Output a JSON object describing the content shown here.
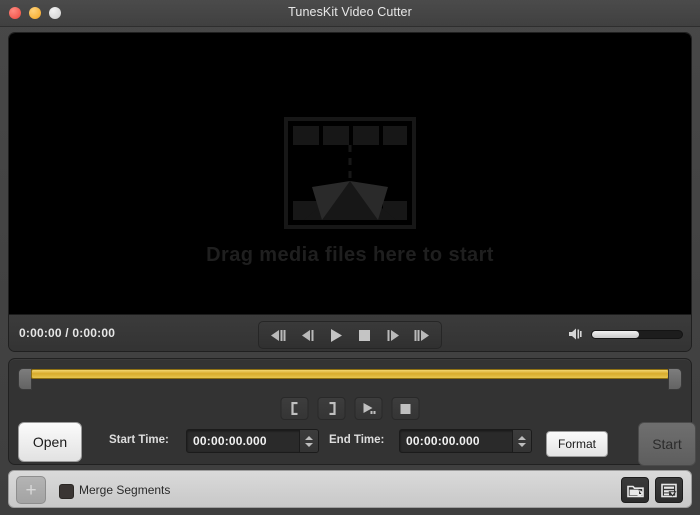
{
  "window": {
    "title": "TunesKit Video Cutter",
    "traffic_lights": [
      {
        "name": "close",
        "color": "#f35c52"
      },
      {
        "name": "minimize",
        "color": "#f8b43c"
      },
      {
        "name": "zoom",
        "color": "#d9d9d9"
      }
    ]
  },
  "video": {
    "drop_hint": "Drag media files here to start",
    "placeholder_icon": "film-strip-cut-icon",
    "background_color": "#000000"
  },
  "transport": {
    "timecode": "0:00:00 / 0:00:00",
    "current_time": "0:00:00",
    "total_time": "0:00:00",
    "buttons": [
      {
        "name": "previous-segment-button",
        "icon": "skip-backward-icon"
      },
      {
        "name": "step-backward-button",
        "icon": "step-backward-icon"
      },
      {
        "name": "play-button",
        "icon": "play-icon"
      },
      {
        "name": "stop-button",
        "icon": "stop-icon"
      },
      {
        "name": "step-forward-button",
        "icon": "step-forward-icon"
      },
      {
        "name": "next-segment-button",
        "icon": "skip-forward-icon"
      }
    ],
    "volume": {
      "icon": "speaker-volume-icon",
      "level_percent": 52
    }
  },
  "timeline": {
    "bar_color": "#d9ac2c",
    "left_handle": "trim-start-handle",
    "right_handle": "trim-end-handle",
    "segment_tools": [
      {
        "name": "set-start-button",
        "icon": "bracket-left-icon",
        "glyph": "["
      },
      {
        "name": "set-end-button",
        "icon": "bracket-right-icon",
        "glyph": "]"
      },
      {
        "name": "preview-segment-button",
        "icon": "play-segment-icon"
      },
      {
        "name": "stop-segment-button",
        "icon": "stop-square-icon"
      }
    ]
  },
  "controls": {
    "open_label": "Open",
    "start_time_label": "Start Time:",
    "start_time_value": "00:00:00.000",
    "end_time_label": "End Time:",
    "end_time_value": "00:00:00.000",
    "time_placeholder": "00:00:00.000",
    "format_label": "Format",
    "start_label": "Start"
  },
  "bottom_bar": {
    "add_label": "+",
    "merge_label": "Merge Segments",
    "merge_checked": false,
    "recent_icon": "recent-folder-icon",
    "output_icon": "output-list-icon"
  }
}
